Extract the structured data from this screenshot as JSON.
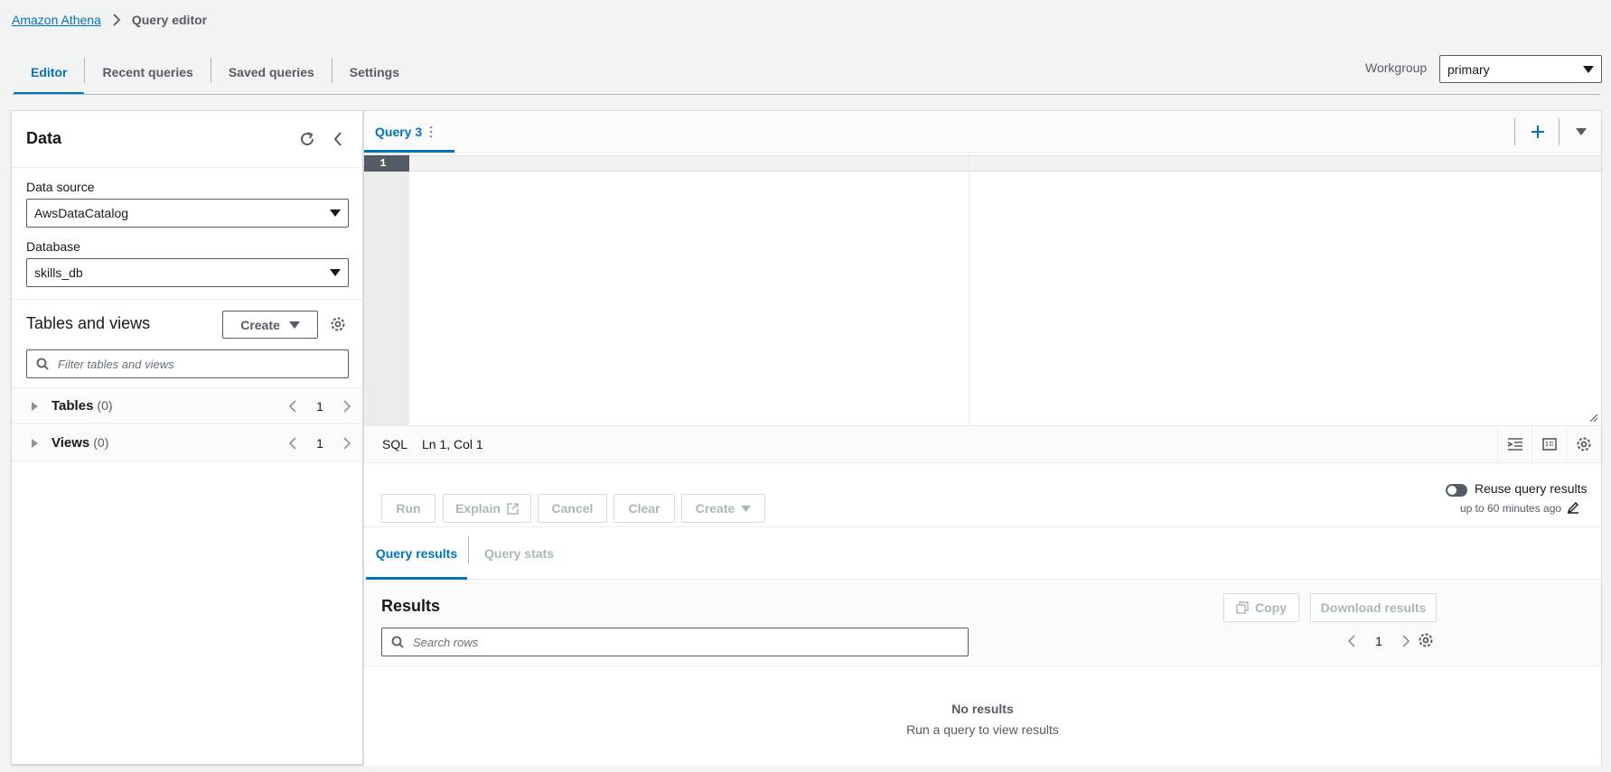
{
  "breadcrumb": {
    "root": "Amazon Athena",
    "current": "Query editor"
  },
  "top_tabs": [
    "Editor",
    "Recent queries",
    "Saved queries",
    "Settings"
  ],
  "workgroup": {
    "label": "Workgroup",
    "value": "primary"
  },
  "data_panel": {
    "title": "Data",
    "data_source": {
      "label": "Data source",
      "value": "AwsDataCatalog"
    },
    "database": {
      "label": "Database",
      "value": "skills_db"
    },
    "tables_views": {
      "title": "Tables and views",
      "create_label": "Create",
      "filter_placeholder": "Filter tables and views"
    },
    "tree": [
      {
        "label": "Tables",
        "count": "(0)",
        "page": "1"
      },
      {
        "label": "Views",
        "count": "(0)",
        "page": "1"
      }
    ]
  },
  "editor": {
    "tab_label": "Query 3",
    "line_number": "1",
    "language": "SQL",
    "cursor": "Ln 1, Col 1"
  },
  "actions": {
    "run": "Run",
    "explain": "Explain",
    "cancel": "Cancel",
    "clear": "Clear",
    "create": "Create",
    "reuse_label": "Reuse query results",
    "reuse_sub": "up to 60 minutes ago"
  },
  "results": {
    "tabs": [
      "Query results",
      "Query stats"
    ],
    "title": "Results",
    "copy": "Copy",
    "download": "Download results",
    "search_placeholder": "Search rows",
    "page": "1",
    "empty_title": "No results",
    "empty_sub": "Run a query to view results"
  },
  "colors": {
    "accent": "#0073bb",
    "text": "#16191f",
    "muted": "#545b64",
    "disabled": "#aab7b8"
  }
}
